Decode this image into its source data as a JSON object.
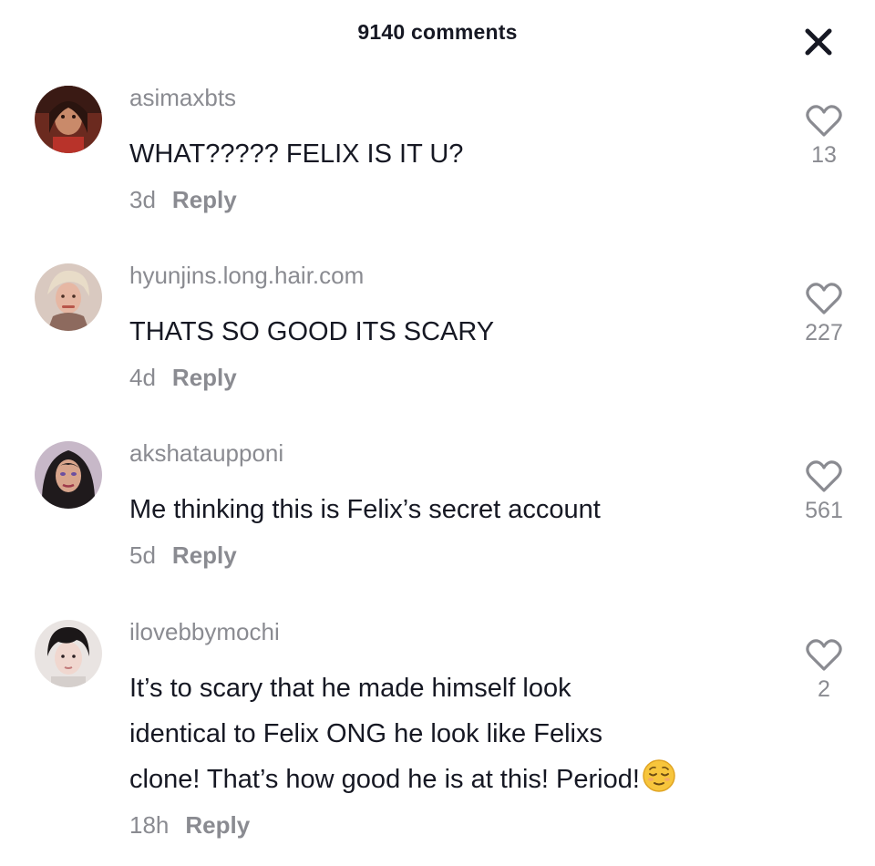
{
  "header": {
    "comment_count": "9140 comments",
    "close_icon": "close-icon"
  },
  "comments": [
    {
      "username": "asimaxbts",
      "text": "WHAT????? FELIX IS IT U?",
      "time": "3d",
      "reply_label": "Reply",
      "likes": "13"
    },
    {
      "username": "hyunjins.long.hair.com",
      "text": "THATS SO GOOD ITS SCARY",
      "time": "4d",
      "reply_label": "Reply",
      "likes": "227"
    },
    {
      "username": "akshataupponi",
      "text": "Me thinking this is Felix’s secret account",
      "time": "5d",
      "reply_label": "Reply",
      "likes": "561"
    },
    {
      "username": "ilovebbymochi",
      "text_lines": [
        "It’s to scary that he made himself look",
        "identical to Felix ONG he look like Felixs",
        "clone! That’s how good he is at this! Period!"
      ],
      "emoji": "relieved-face-emoji",
      "time": "18h",
      "reply_label": "Reply",
      "likes": "2"
    }
  ],
  "colors": {
    "primary_text": "#161823",
    "secondary_text": "#8a8b91",
    "background": "#ffffff"
  }
}
